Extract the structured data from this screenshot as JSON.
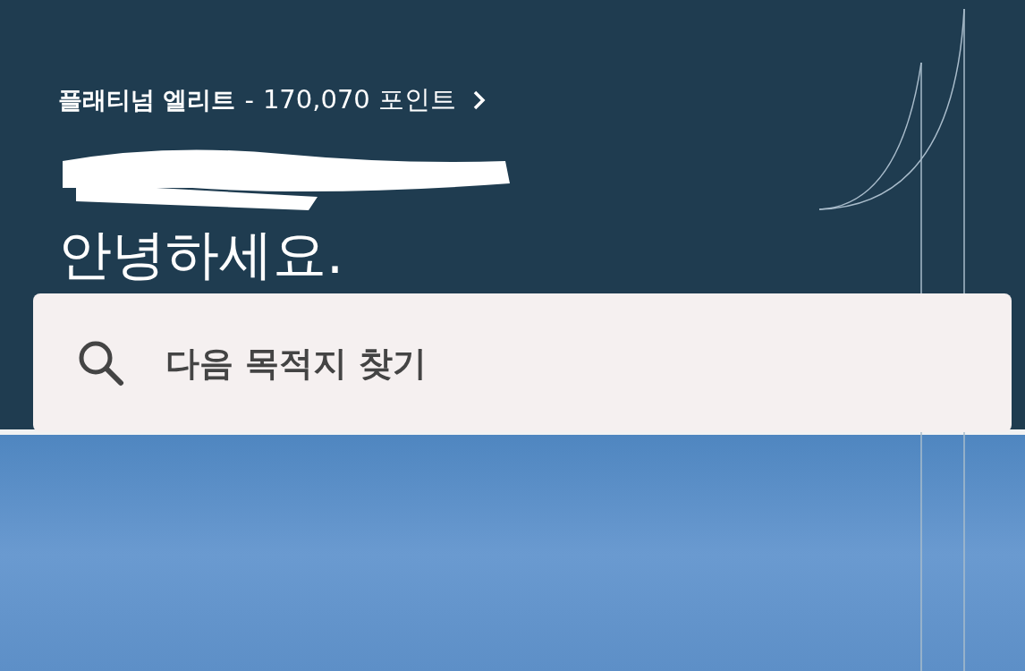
{
  "membership": {
    "tier": "플래티넘 엘리트",
    "separator": "-",
    "points": "170,070 포인트"
  },
  "greeting": "안녕하세요.",
  "search": {
    "placeholder": "다음 목적지 찾기"
  }
}
